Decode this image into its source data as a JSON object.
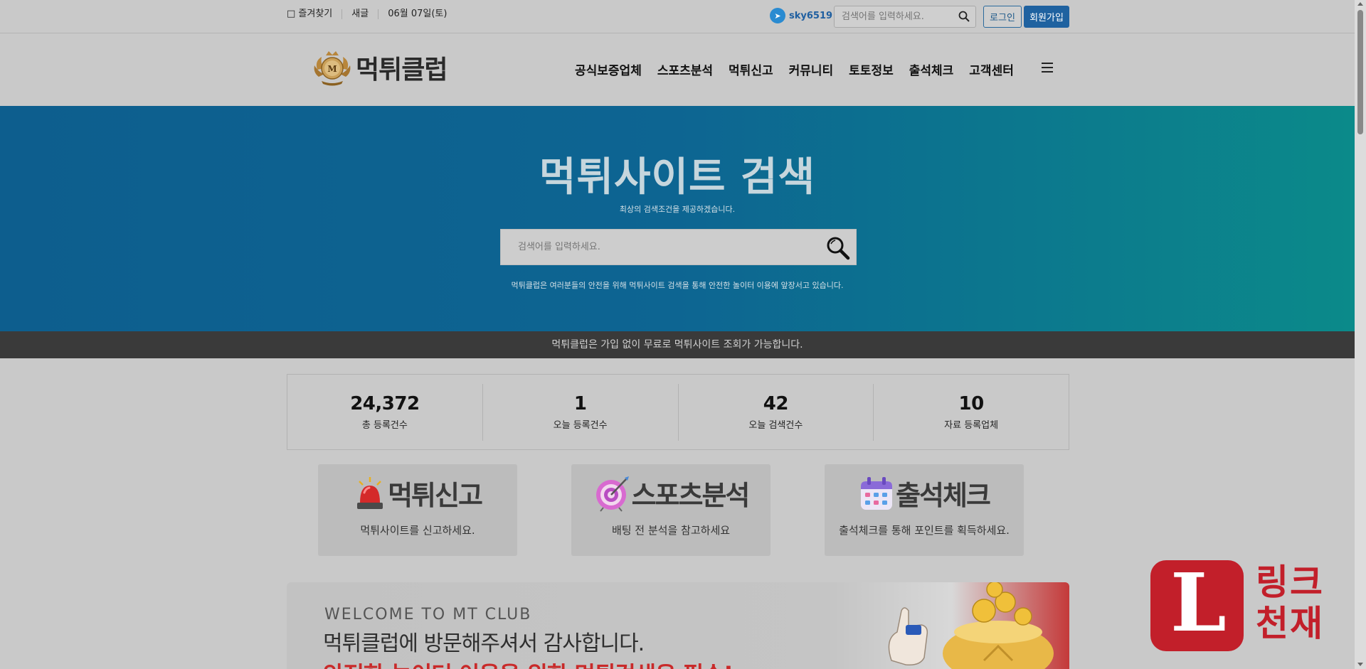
{
  "topbar": {
    "bookmark": "즐겨찾기",
    "new_post": "새글",
    "date": "06월 07일(토)",
    "telegram_id": "sky6519",
    "search_placeholder": "검색어를 입력하세요.",
    "login_label": "로그인",
    "join_label": "회원가입"
  },
  "header": {
    "logo_text": "먹튀클럽",
    "nav": [
      "공식보증업체",
      "스포츠분석",
      "먹튀신고",
      "커뮤니티",
      "토토정보",
      "출석체크",
      "고객센터"
    ]
  },
  "hero": {
    "title": "먹튀사이트 검색",
    "subtitle": "최상의 검색조건을 제공하겠습니다.",
    "search_placeholder": "검색어를 입력하세요.",
    "note": "먹튀클럽은 여러분들의 안전을 위해 먹튀사이트 검색을 통해 안전한 놀이터 이용에 앞장서고 있습니다."
  },
  "band": {
    "text": "먹튀클럽은 가입 없이 무료로 먹튀사이트 조회가 가능합니다."
  },
  "stats": [
    {
      "value": "24,372",
      "label": "총 등록건수"
    },
    {
      "value": "1",
      "label": "오늘 등록건수"
    },
    {
      "value": "42",
      "label": "오늘 검색건수"
    },
    {
      "value": "10",
      "label": "자료 등록업체"
    }
  ],
  "cards": [
    {
      "title": "먹튀신고",
      "desc": "먹튀사이트를 신고하세요."
    },
    {
      "title": "스포츠분석",
      "desc": "배팅 전 분석을 참고하세요"
    },
    {
      "title": "출석체크",
      "desc": "출석체크를 통해 포인트를 획득하세요."
    }
  ],
  "welcome": {
    "eng": "WELCOME TO MT CLUB",
    "kor": "먹튀클럽에 방문해주셔서 감사합니다.",
    "red": "안전한 놀이터 이용을 위한 먹튀검색은 필수!"
  },
  "badge": {
    "letter": "L",
    "line1": "링크",
    "line2": "천재"
  },
  "colors": {
    "hero_start": "#0d5e8e",
    "hero_end": "#0b8a8a",
    "brand_blue": "#1f62a0",
    "badge_red": "#c21f2a"
  }
}
